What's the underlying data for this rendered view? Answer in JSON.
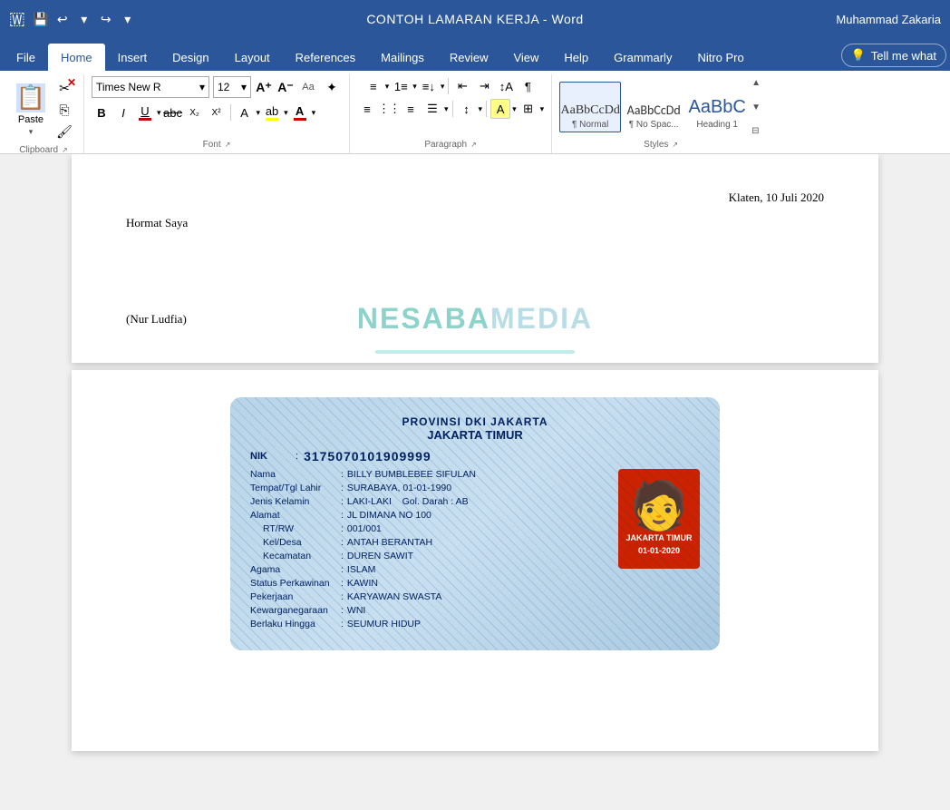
{
  "titlebar": {
    "title": "CONTOH LAMARAN KERJA  -  Word",
    "user": "Muhammad Zakaria",
    "save_icon": "💾",
    "undo_icon": "↩",
    "redo_icon": "↪",
    "dropdown_icon": "▾"
  },
  "ribbon": {
    "tabs": [
      {
        "label": "File",
        "active": false
      },
      {
        "label": "Home",
        "active": true
      },
      {
        "label": "Insert",
        "active": false
      },
      {
        "label": "Design",
        "active": false
      },
      {
        "label": "Layout",
        "active": false
      },
      {
        "label": "References",
        "active": false
      },
      {
        "label": "Mailings",
        "active": false
      },
      {
        "label": "Review",
        "active": false
      },
      {
        "label": "View",
        "active": false
      },
      {
        "label": "Help",
        "active": false
      },
      {
        "label": "Grammarly",
        "active": false
      },
      {
        "label": "Nitro Pro",
        "active": false
      }
    ],
    "tell_me_placeholder": "Tell me what",
    "clipboard": {
      "paste_label": "Paste",
      "group_label": "Clipboard"
    },
    "font": {
      "name": "Times New R",
      "size": "12",
      "group_label": "Font"
    },
    "paragraph": {
      "group_label": "Paragraph"
    },
    "styles": {
      "items": [
        {
          "label": "¶ Normal",
          "preview": "AaBbCcDd",
          "type": "normal",
          "active": true
        },
        {
          "label": "¶ No Spac...",
          "preview": "AaBbCcDd",
          "type": "nospace",
          "active": false
        },
        {
          "label": "Heading 1",
          "preview": "AaBbC",
          "type": "h1",
          "active": false
        }
      ],
      "group_label": "Styles"
    }
  },
  "document": {
    "page1": {
      "date": "Klaten, 10 Juli 2020",
      "greeting": "Hormat Saya",
      "signature": "(Nur Ludfia)"
    },
    "page2": {
      "watermark": "NESABAMEDIA",
      "ktp": {
        "province": "PROVINSI DKI JAKARTA",
        "city": "JAKARTA TIMUR",
        "nik_label": "NIK",
        "nik_value": "3175070101909999",
        "fields": [
          {
            "label": "Nama",
            "value": "BILLY BUMBLEBEE SIFULAN"
          },
          {
            "label": "Tempat/Tgl Lahir",
            "value": "SURABAYA, 01-01-1990"
          },
          {
            "label": "Jenis Kelamin",
            "value": "LAKI-LAKI    Gol. Darah : AB"
          },
          {
            "label": "Alamat",
            "value": "JL DIMANA NO 100"
          },
          {
            "label": "RT/RW",
            "value": "001/001"
          },
          {
            "label": "Kel/Desa",
            "value": "ANTAH BERANTAH"
          },
          {
            "label": "Kecamatan",
            "value": "DUREN SAWIT"
          },
          {
            "label": "Agama",
            "value": "ISLAM"
          },
          {
            "label": "Status Perkawinan",
            "value": "KAWIN"
          },
          {
            "label": "Pekerjaan",
            "value": "KARYAWAN SWASTA"
          },
          {
            "label": "Kewarganegaraan",
            "value": "WNI"
          },
          {
            "label": "Berlaku Hingga",
            "value": "SEUMUR HIDUP"
          }
        ],
        "photo_city": "JAKARTA TIMUR",
        "photo_date": "01-01-2020"
      }
    }
  }
}
